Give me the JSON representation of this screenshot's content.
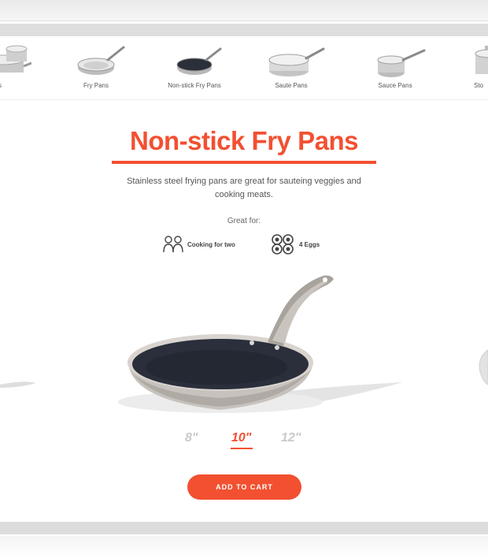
{
  "categories": [
    {
      "label": "s"
    },
    {
      "label": "Fry Pans"
    },
    {
      "label": "Non-stick Fry Pans"
    },
    {
      "label": "Saute Pans"
    },
    {
      "label": "Sauce Pans"
    },
    {
      "label": "Sto"
    }
  ],
  "product": {
    "title": "Non-stick Fry Pans",
    "description": "Stainless steel frying pans are great for sauteing veggies and cooking meats.",
    "great_for_label": "Great for:",
    "features": [
      {
        "icon": "people-icon",
        "label": "Cooking for two"
      },
      {
        "icon": "eggs-icon",
        "label": "4 Eggs"
      }
    ],
    "sizes": [
      "8\"",
      "10\"",
      "12\""
    ],
    "selected_size": "10\"",
    "cta": "ADD TO CART"
  },
  "colors": {
    "accent": "#f25031",
    "inactive_size": "#c9c9c9"
  }
}
